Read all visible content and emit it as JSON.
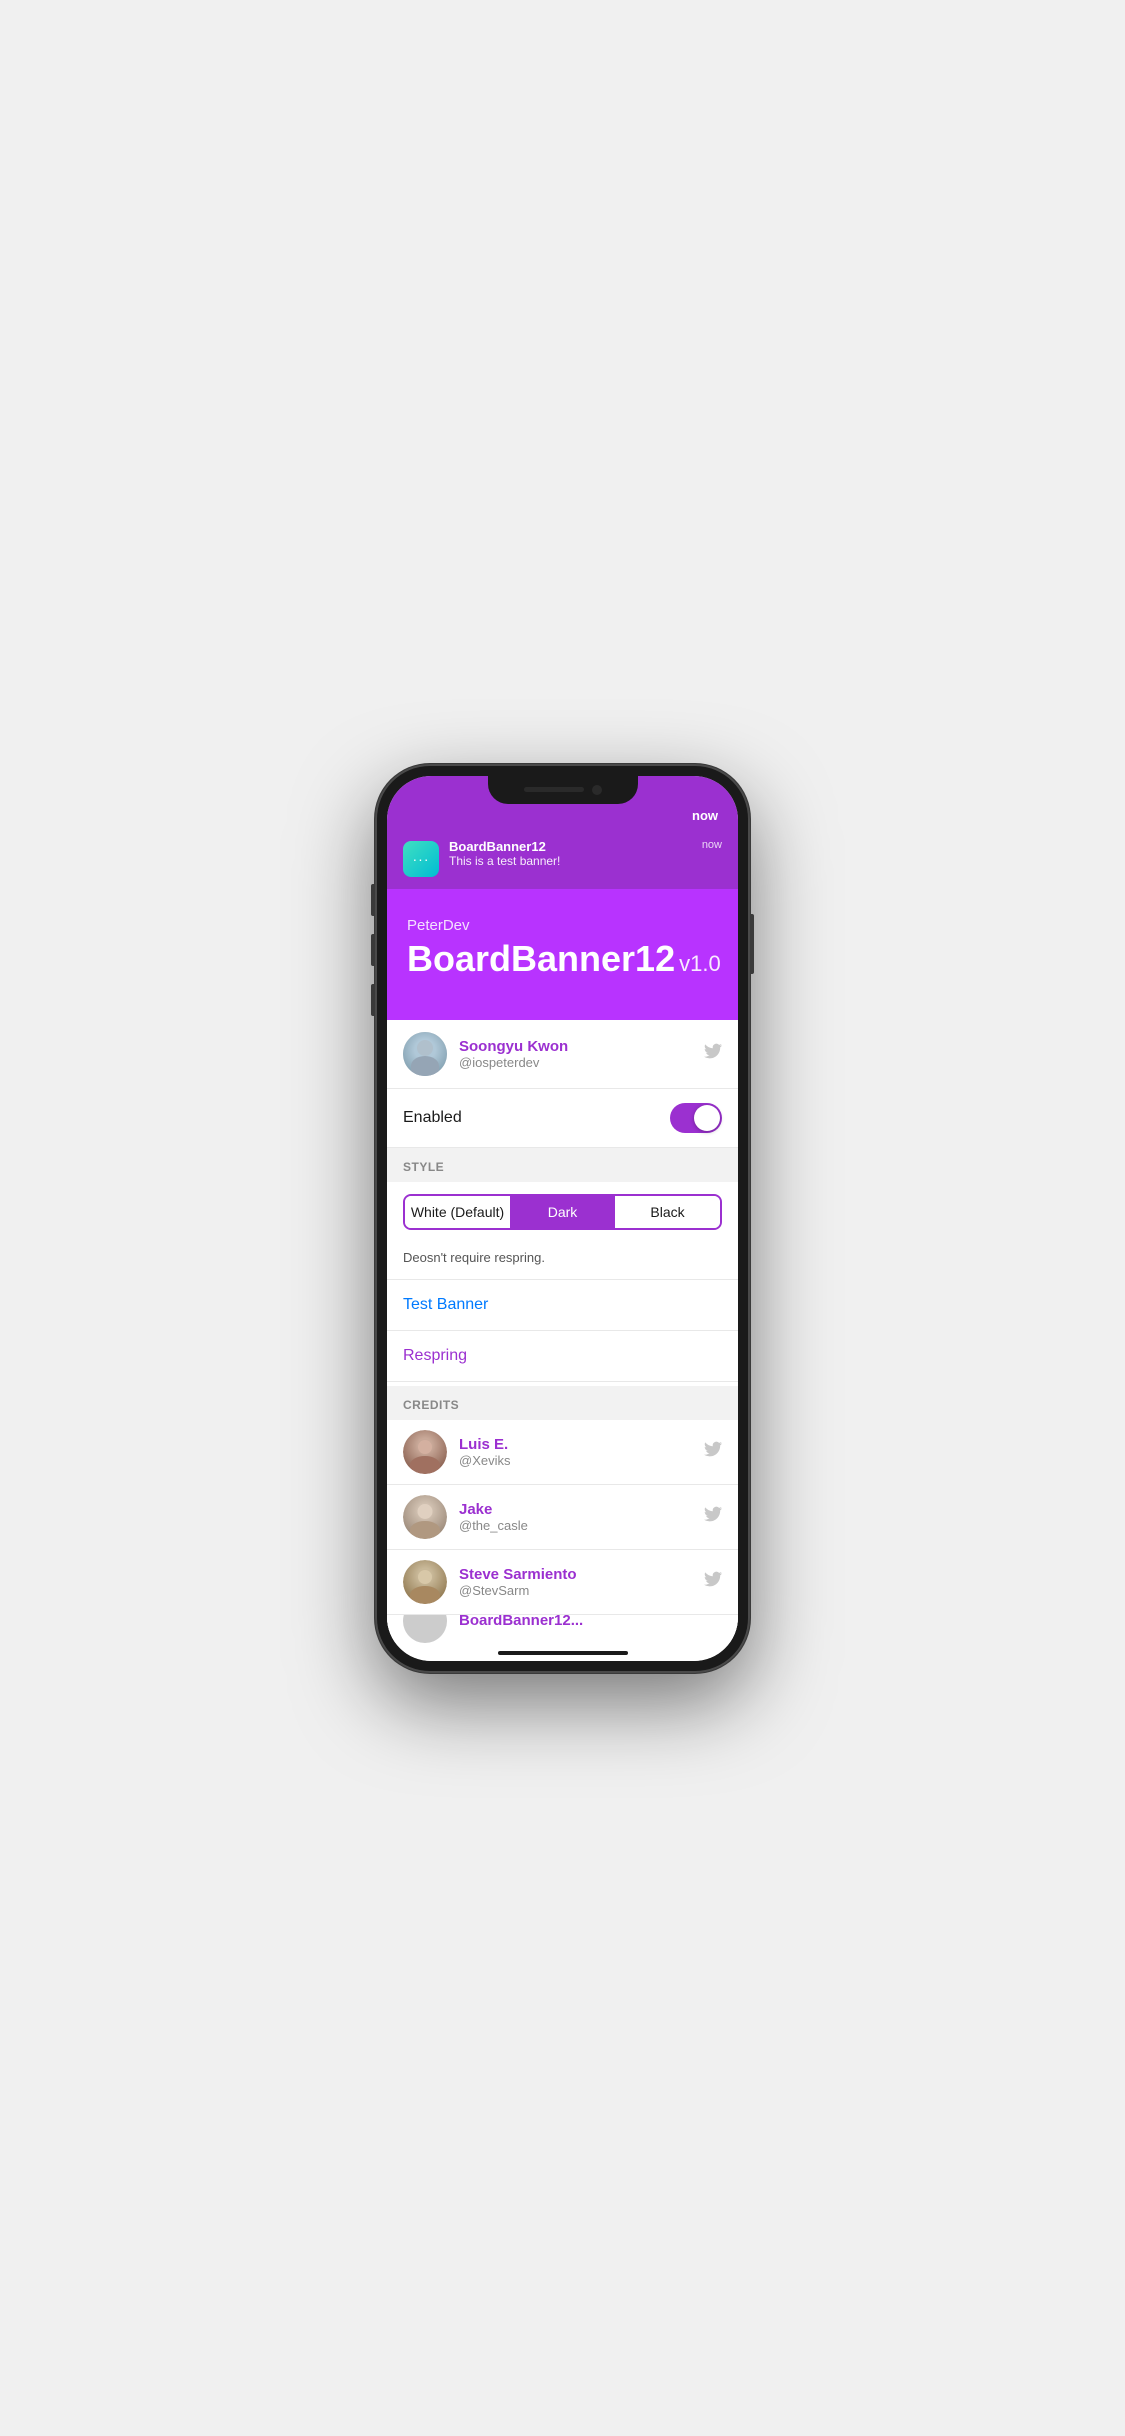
{
  "phone": {
    "status_time": "now"
  },
  "notification": {
    "icon_label": "···",
    "title": "BoardBanner12",
    "subtitle": "This is a test banner!",
    "time": "now"
  },
  "hero": {
    "developer": "PeterDev",
    "app_name": "BoardBanner12",
    "version": "v1.0"
  },
  "developer": {
    "name": "Soongyu Kwon",
    "handle": "@iospeterdev",
    "avatar_alt": "Soongyu avatar"
  },
  "settings": {
    "enabled_label": "Enabled",
    "toggle_on": true,
    "style_section_title": "STYLE",
    "style_options": [
      {
        "id": "white",
        "label": "White (Default)",
        "active": false
      },
      {
        "id": "dark",
        "label": "Dark",
        "active": true
      },
      {
        "id": "black",
        "label": "Black",
        "active": false
      }
    ],
    "style_note": "Deosn't require respring.",
    "test_banner_label": "Test Banner",
    "respring_label": "Respring"
  },
  "credits": {
    "section_title": "CREDITS",
    "people": [
      {
        "name": "Luis E.",
        "handle": "@Xeviks",
        "avatar_color": "#c0a090"
      },
      {
        "name": "Jake",
        "handle": "@the_casle",
        "avatar_color": "#b0b8b0"
      },
      {
        "name": "Steve Sarmiento",
        "handle": "@StevSarm",
        "avatar_color": "#c8b890"
      }
    ]
  }
}
